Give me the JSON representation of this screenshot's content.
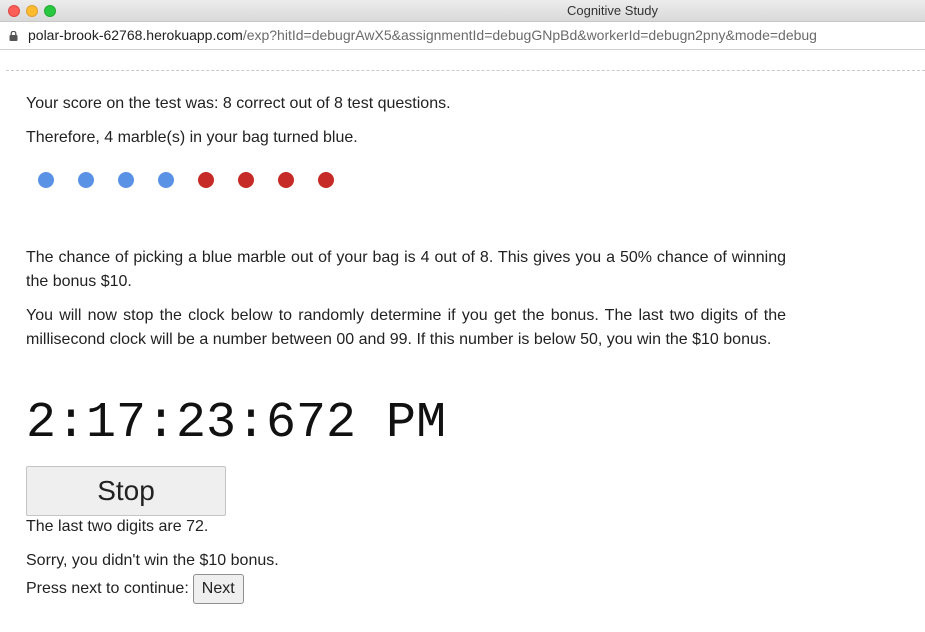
{
  "window": {
    "title": "Cognitive Study"
  },
  "url_bar": {
    "host": "polar-brook-62768.herokuapp.com",
    "path": "/exp?hitId=debugrAwX5&assignmentId=debugGNpBd&workerId=debugn2pny&mode=debug"
  },
  "result": {
    "score_text": "Your score on the test was: 8 correct out of 8 test questions.",
    "turned_text": "Therefore, 4 marble(s) in your bag turned blue.",
    "blue_count": 4,
    "total_marbles": 8
  },
  "marbles": [
    "blue",
    "blue",
    "blue",
    "blue",
    "red",
    "red",
    "red",
    "red"
  ],
  "colors": {
    "blue": "#5a93e6",
    "red": "#c62b27"
  },
  "instructions": {
    "chance_text": "The chance of picking a blue marble out of your bag is 4 out of 8. This gives you a 50% chance of winning the bonus $10.",
    "clock_text": "You will now stop the clock below to randomly determine if you get the bonus. The last two digits of the millisecond clock will be a number between 00 and 99. If this number is below 50, you win the $10 bonus."
  },
  "clock": {
    "display": "2:17:23:672 PM"
  },
  "stop_button": {
    "label": "Stop"
  },
  "outcome": {
    "digits_text": "The last two digits are 72.",
    "result_text": "Sorry, you didn't win the $10 bonus.",
    "continue_text": "Press next to continue:",
    "next_label": "Next"
  }
}
